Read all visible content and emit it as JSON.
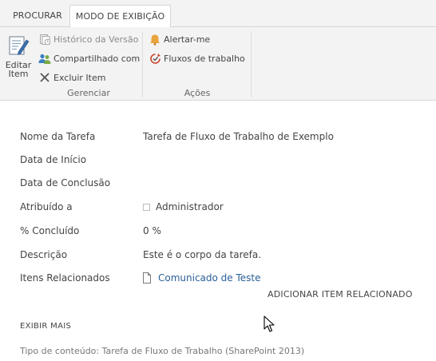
{
  "ribbon": {
    "tabs": [
      {
        "label": "PROCURAR",
        "active": false
      },
      {
        "label": "MODO DE EXIBIÇÃO",
        "active": true
      }
    ],
    "groups": {
      "gerenciar": {
        "label": "Gerenciar",
        "edit_item": {
          "line1": "Editar",
          "line2": "Item",
          "icon": "edit-document-icon"
        },
        "version_history": {
          "label": "Histórico da Versão",
          "icon": "version-history-icon",
          "enabled": false
        },
        "shared_with": {
          "label": "Compartilhado com",
          "icon": "people-icon"
        },
        "delete_item": {
          "label": "Excluir Item",
          "icon": "delete-x-icon"
        }
      },
      "acoes": {
        "label": "Ações",
        "alert_me": {
          "label": "Alertar-me",
          "icon": "bell-icon"
        },
        "workflows": {
          "label": "Fluxos de trabalho",
          "icon": "workflow-icon"
        }
      }
    }
  },
  "form": {
    "fields": [
      {
        "label": "Nome da Tarefa",
        "value": "Tarefa de Fluxo de Trabalho de Exemplo"
      },
      {
        "label": "Data de Início",
        "value": ""
      },
      {
        "label": "Data de Conclusão",
        "value": ""
      },
      {
        "label": "Atribuído a",
        "value": "Administrador"
      },
      {
        "label": "% Concluído",
        "value": "0 %"
      },
      {
        "label": "Descrição",
        "value": "Este é o corpo da tarefa."
      },
      {
        "label": "Itens Relacionados",
        "value": "Comunicado de Teste"
      }
    ],
    "add_related": "ADICIONAR ITEM RELACIONADO",
    "show_more": "EXIBIR MAIS",
    "content_type": "Tipo de conteúdo: Tarefa de Fluxo de Trabalho (SharePoint 2013)"
  },
  "colors": {
    "ribbon_bg": "#f3f3f3",
    "link": "#2a6099",
    "bell": "#e8a33a",
    "workflow_red": "#c8462b",
    "people_blue": "#3a7fc1"
  }
}
